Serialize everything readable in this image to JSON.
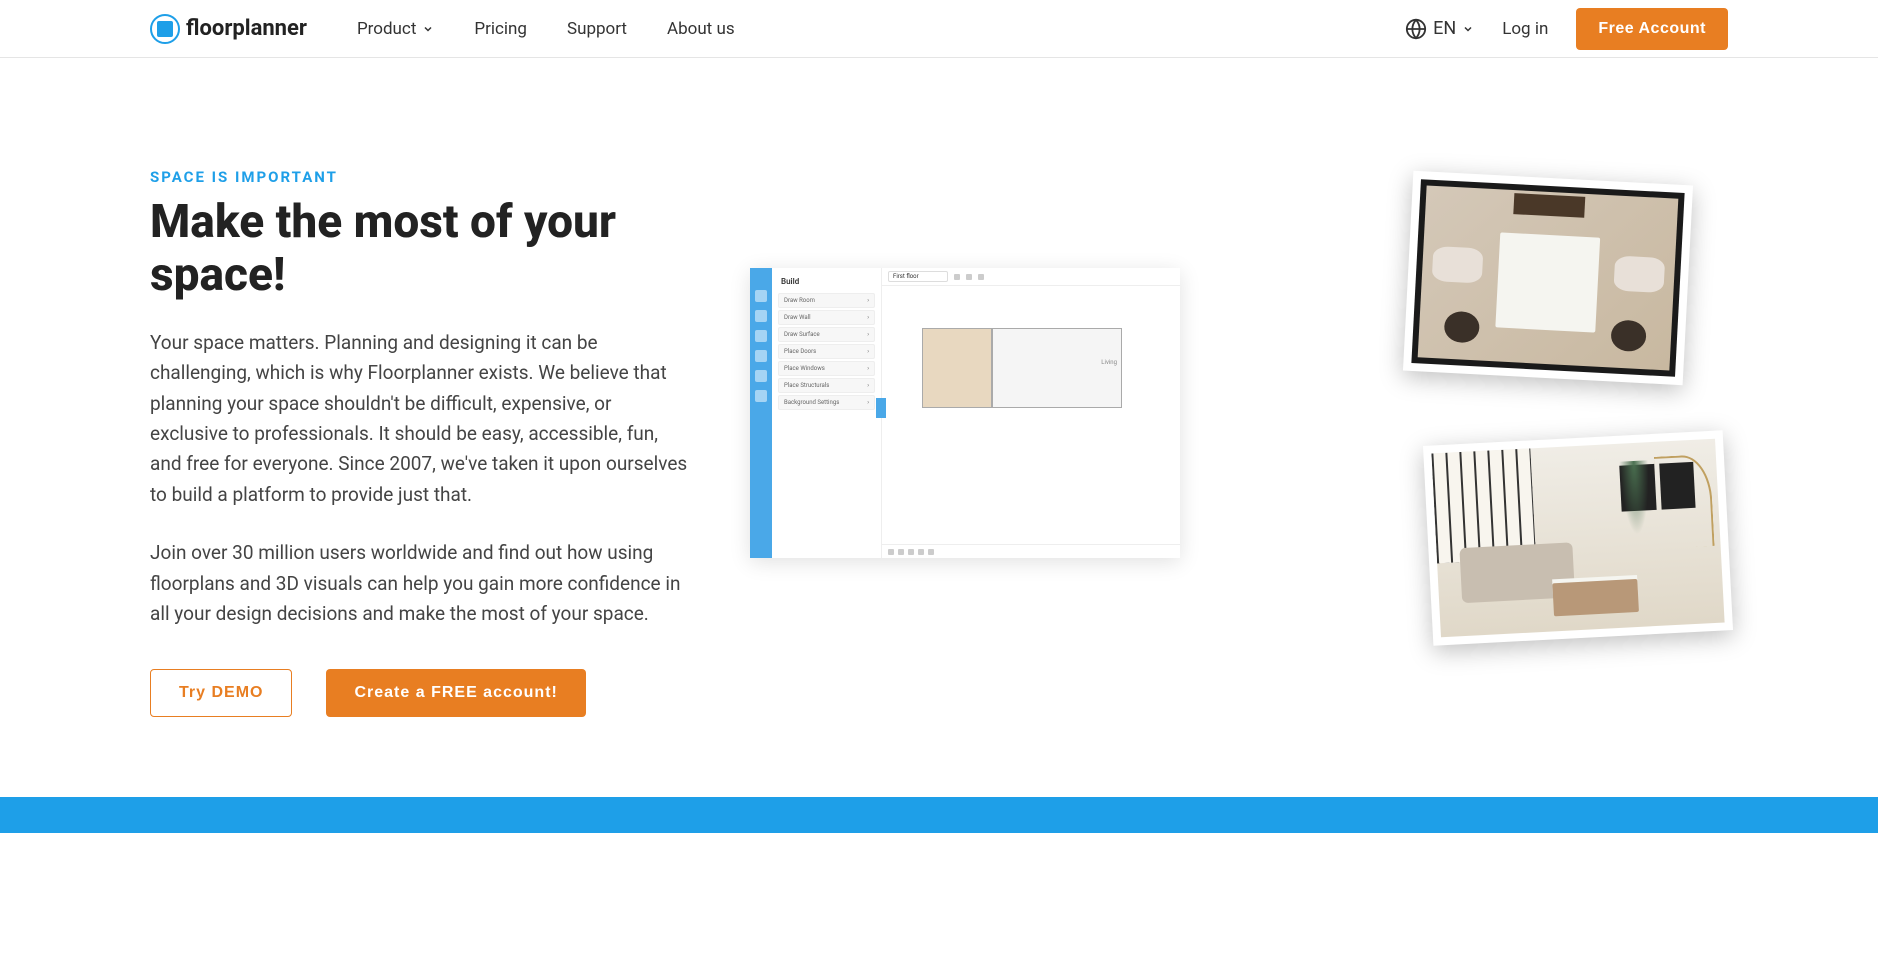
{
  "nav": {
    "brand": "floorplanner",
    "items": {
      "product": "Product",
      "pricing": "Pricing",
      "support": "Support",
      "about": "About us"
    },
    "language": "EN",
    "login": "Log in",
    "cta": "Free Account"
  },
  "hero": {
    "eyebrow": "SPACE IS IMPORTANT",
    "title": "Make the most of your space!",
    "para1": "Your space matters. Planning and designing it can be challenging, which is why Floorplanner exists. We believe that planning your space shouldn't be difficult, expensive, or exclusive to professionals. It should be easy, accessible, fun, and free for everyone. Since 2007, we've taken it upon ourselves to build a platform to provide just that.",
    "para2": "Join over 30 million users worldwide and find out how using floorplans and 3D visuals can help you gain more confidence in all your design decisions and make the most of your space.",
    "demo_btn": "Try DEMO",
    "create_btn": "Create a FREE account!"
  },
  "mock": {
    "floor_label": "First floor",
    "panel_title": "Build",
    "items": {
      "draw_room": "Draw Room",
      "draw_wall": "Draw Wall",
      "draw_surface": "Draw Surface",
      "place_doors": "Place Doors",
      "place_windows": "Place Windows",
      "place_structurals": "Place Structurals",
      "background_settings": "Background Settings"
    },
    "room_label": "Living"
  }
}
